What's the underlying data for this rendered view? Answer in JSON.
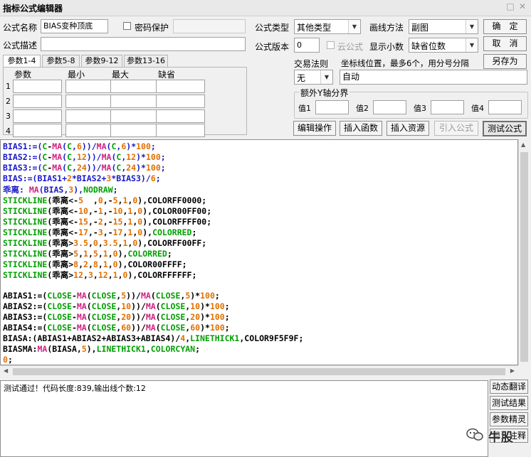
{
  "window": {
    "title": "指标公式编辑器"
  },
  "form": {
    "name_label": "公式名称",
    "name_value": "BIAS变种顶底",
    "password_label": "密码保护",
    "desc_label": "公式描述",
    "type_label": "公式类型",
    "type_value": "其他类型",
    "draw_label": "画线方法",
    "draw_value": "副图",
    "version_label": "公式版本",
    "version_value": "0",
    "cloud_label": "云公式",
    "decimals_label": "显示小数",
    "decimals_value": "缺省位数",
    "trade_rule_label": "交易法则",
    "trade_rule_value": "无",
    "coord_label": "坐标线位置，最多6个，用分号分隔",
    "coord_value": "自动",
    "yaxis_group_label": "额外Y轴分界",
    "yaxis_fields": [
      "值1",
      "值2",
      "值3",
      "值4"
    ]
  },
  "buttons": {
    "ok": "确　定",
    "cancel": "取　消",
    "save_as": "另存为",
    "edit_ops": "编辑操作",
    "insert_func": "插入函数",
    "insert_res": "插入资源",
    "import_formula": "引入公式",
    "test_formula": "测试公式"
  },
  "params": {
    "tabs": [
      "参数1-4",
      "参数5-8",
      "参数9-12",
      "参数13-16"
    ],
    "headers": [
      "参数",
      "最小",
      "最大",
      "缺省"
    ],
    "rows": [
      "1",
      "2",
      "3",
      "4"
    ]
  },
  "code_lines": [
    [
      [
        "BIAS1:=(",
        "#1818c8"
      ],
      [
        "C",
        "#00a000"
      ],
      [
        "-",
        "#000000"
      ],
      [
        "MA",
        "#d02080"
      ],
      [
        "(",
        "#1818c8"
      ],
      [
        "C",
        "#00a000"
      ],
      [
        ",",
        "#1818c8"
      ],
      [
        "6",
        "#e07000"
      ],
      [
        "))/",
        "#1818c8"
      ],
      [
        "MA",
        "#d02080"
      ],
      [
        "(",
        "#1818c8"
      ],
      [
        "C",
        "#00a000"
      ],
      [
        ",",
        "#1818c8"
      ],
      [
        "6",
        "#e07000"
      ],
      [
        ")*",
        "#1818c8"
      ],
      [
        "100",
        "#e07000"
      ],
      [
        ";",
        "#1818c8"
      ]
    ],
    [
      [
        "BIAS2:=(",
        "#1818c8"
      ],
      [
        "C",
        "#00a000"
      ],
      [
        "-",
        "#000000"
      ],
      [
        "MA",
        "#d02080"
      ],
      [
        "(",
        "#1818c8"
      ],
      [
        "C",
        "#00a000"
      ],
      [
        ",",
        "#1818c8"
      ],
      [
        "12",
        "#e07000"
      ],
      [
        "))/",
        "#1818c8"
      ],
      [
        "MA",
        "#d02080"
      ],
      [
        "(",
        "#1818c8"
      ],
      [
        "C",
        "#00a000"
      ],
      [
        ",",
        "#1818c8"
      ],
      [
        "12",
        "#e07000"
      ],
      [
        ")*",
        "#1818c8"
      ],
      [
        "100",
        "#e07000"
      ],
      [
        ";",
        "#1818c8"
      ]
    ],
    [
      [
        "BIAS3:=(",
        "#1818c8"
      ],
      [
        "C",
        "#00a000"
      ],
      [
        "-",
        "#000000"
      ],
      [
        "MA",
        "#d02080"
      ],
      [
        "(",
        "#1818c8"
      ],
      [
        "C",
        "#00a000"
      ],
      [
        ",",
        "#1818c8"
      ],
      [
        "24",
        "#e07000"
      ],
      [
        "))/",
        "#1818c8"
      ],
      [
        "MA",
        "#d02080"
      ],
      [
        "(",
        "#1818c8"
      ],
      [
        "C",
        "#00a000"
      ],
      [
        ",",
        "#1818c8"
      ],
      [
        "24",
        "#e07000"
      ],
      [
        ")*",
        "#1818c8"
      ],
      [
        "100",
        "#e07000"
      ],
      [
        ";",
        "#1818c8"
      ]
    ],
    [
      [
        "BIAS:=(BIAS1+",
        "#1818c8"
      ],
      [
        "2",
        "#e07000"
      ],
      [
        "*BIAS2+",
        "#1818c8"
      ],
      [
        "3",
        "#e07000"
      ],
      [
        "*BIAS3)/",
        "#1818c8"
      ],
      [
        "6",
        "#e07000"
      ],
      [
        ";",
        "#1818c8"
      ]
    ],
    [
      [
        "乖离:",
        "#1818c8"
      ],
      [
        " MA",
        "#d02080"
      ],
      [
        "(BIAS,",
        "#1818c8"
      ],
      [
        "3",
        "#e07000"
      ],
      [
        "),",
        "#1818c8"
      ],
      [
        "NODRAW",
        "#00a000"
      ],
      [
        ";",
        "#1818c8"
      ]
    ],
    [
      [
        "STICKLINE",
        "#00a000"
      ],
      [
        "(乖离<-",
        "#000000"
      ],
      [
        "5",
        "#e07000"
      ],
      [
        "  ,",
        "#000000"
      ],
      [
        "0",
        "#e07000"
      ],
      [
        ",-",
        "#000000"
      ],
      [
        "5",
        "#e07000"
      ],
      [
        ",",
        "#000000"
      ],
      [
        "1",
        "#e07000"
      ],
      [
        ",",
        "#000000"
      ],
      [
        "0",
        "#e07000"
      ],
      [
        "),COLORFF0000;",
        "#000000"
      ]
    ],
    [
      [
        "STICKLINE",
        "#00a000"
      ],
      [
        "(乖离<-",
        "#000000"
      ],
      [
        "10",
        "#e07000"
      ],
      [
        ",-",
        "#000000"
      ],
      [
        "1",
        "#e07000"
      ],
      [
        ",-",
        "#000000"
      ],
      [
        "10",
        "#e07000"
      ],
      [
        ",",
        "#000000"
      ],
      [
        "1",
        "#e07000"
      ],
      [
        ",",
        "#000000"
      ],
      [
        "0",
        "#e07000"
      ],
      [
        "),COLOR00FF00;",
        "#000000"
      ]
    ],
    [
      [
        "STICKLINE",
        "#00a000"
      ],
      [
        "(乖离<-",
        "#000000"
      ],
      [
        "15",
        "#e07000"
      ],
      [
        ",-",
        "#000000"
      ],
      [
        "2",
        "#e07000"
      ],
      [
        ",-",
        "#000000"
      ],
      [
        "15",
        "#e07000"
      ],
      [
        ",",
        "#000000"
      ],
      [
        "1",
        "#e07000"
      ],
      [
        ",",
        "#000000"
      ],
      [
        "0",
        "#e07000"
      ],
      [
        "),COLORFFFF00;",
        "#000000"
      ]
    ],
    [
      [
        "STICKLINE",
        "#00a000"
      ],
      [
        "(乖离<-",
        "#000000"
      ],
      [
        "17",
        "#e07000"
      ],
      [
        ",-",
        "#000000"
      ],
      [
        "3",
        "#e07000"
      ],
      [
        ",-",
        "#000000"
      ],
      [
        "17",
        "#e07000"
      ],
      [
        ",",
        "#000000"
      ],
      [
        "1",
        "#e07000"
      ],
      [
        ",",
        "#000000"
      ],
      [
        "0",
        "#e07000"
      ],
      [
        "),",
        "#000000"
      ],
      [
        "COLORRED",
        "#00a000"
      ],
      [
        ";",
        "#000000"
      ]
    ],
    [
      [
        "STICKLINE",
        "#00a000"
      ],
      [
        "(乖离>",
        "#000000"
      ],
      [
        "3.5",
        "#e07000"
      ],
      [
        ",",
        "#000000"
      ],
      [
        "0",
        "#e07000"
      ],
      [
        ",",
        "#000000"
      ],
      [
        "3.5",
        "#e07000"
      ],
      [
        ",",
        "#000000"
      ],
      [
        "1",
        "#e07000"
      ],
      [
        ",",
        "#000000"
      ],
      [
        "0",
        "#e07000"
      ],
      [
        "),COLORFF00FF;",
        "#000000"
      ]
    ],
    [
      [
        "STICKLINE",
        "#00a000"
      ],
      [
        "(乖离>",
        "#000000"
      ],
      [
        "5",
        "#e07000"
      ],
      [
        ",",
        "#000000"
      ],
      [
        "1",
        "#e07000"
      ],
      [
        ",",
        "#000000"
      ],
      [
        "5",
        "#e07000"
      ],
      [
        ",",
        "#000000"
      ],
      [
        "1",
        "#e07000"
      ],
      [
        ",",
        "#000000"
      ],
      [
        "0",
        "#e07000"
      ],
      [
        "),",
        "#000000"
      ],
      [
        "COLORRED",
        "#00a000"
      ],
      [
        ";",
        "#000000"
      ]
    ],
    [
      [
        "STICKLINE",
        "#00a000"
      ],
      [
        "(乖离>",
        "#000000"
      ],
      [
        "8",
        "#e07000"
      ],
      [
        ",",
        "#000000"
      ],
      [
        "2",
        "#e07000"
      ],
      [
        ",",
        "#000000"
      ],
      [
        "8",
        "#e07000"
      ],
      [
        ",",
        "#000000"
      ],
      [
        "1",
        "#e07000"
      ],
      [
        ",",
        "#000000"
      ],
      [
        "0",
        "#e07000"
      ],
      [
        "),COLOR00FFFF;",
        "#000000"
      ]
    ],
    [
      [
        "STICKLINE",
        "#00a000"
      ],
      [
        "(乖离>",
        "#000000"
      ],
      [
        "12",
        "#e07000"
      ],
      [
        ",",
        "#000000"
      ],
      [
        "3",
        "#e07000"
      ],
      [
        ",",
        "#000000"
      ],
      [
        "12",
        "#e07000"
      ],
      [
        ",",
        "#000000"
      ],
      [
        "1",
        "#e07000"
      ],
      [
        ",",
        "#000000"
      ],
      [
        "0",
        "#e07000"
      ],
      [
        "),COLORFFFFFF;",
        "#000000"
      ]
    ],
    [],
    [
      [
        "ABIAS1:=(",
        "#000000"
      ],
      [
        "CLOSE",
        "#00a000"
      ],
      [
        "-",
        "#000000"
      ],
      [
        "MA",
        "#d02080"
      ],
      [
        "(",
        "#000000"
      ],
      [
        "CLOSE",
        "#00a000"
      ],
      [
        ",",
        "#000000"
      ],
      [
        "5",
        "#e07000"
      ],
      [
        "))/",
        "#000000"
      ],
      [
        "MA",
        "#d02080"
      ],
      [
        "(",
        "#000000"
      ],
      [
        "CLOSE",
        "#00a000"
      ],
      [
        ",",
        "#000000"
      ],
      [
        "5",
        "#e07000"
      ],
      [
        ")*",
        "#000000"
      ],
      [
        "100",
        "#e07000"
      ],
      [
        ";",
        "#000000"
      ]
    ],
    [
      [
        "ABIAS2:=(",
        "#000000"
      ],
      [
        "CLOSE",
        "#00a000"
      ],
      [
        "-",
        "#000000"
      ],
      [
        "MA",
        "#d02080"
      ],
      [
        "(",
        "#000000"
      ],
      [
        "CLOSE",
        "#00a000"
      ],
      [
        ",",
        "#000000"
      ],
      [
        "10",
        "#e07000"
      ],
      [
        "))/",
        "#000000"
      ],
      [
        "MA",
        "#d02080"
      ],
      [
        "(",
        "#000000"
      ],
      [
        "CLOSE",
        "#00a000"
      ],
      [
        ",",
        "#000000"
      ],
      [
        "10",
        "#e07000"
      ],
      [
        ")*",
        "#000000"
      ],
      [
        "100",
        "#e07000"
      ],
      [
        ";",
        "#000000"
      ]
    ],
    [
      [
        "ABIAS3:=(",
        "#000000"
      ],
      [
        "CLOSE",
        "#00a000"
      ],
      [
        "-",
        "#000000"
      ],
      [
        "MA",
        "#d02080"
      ],
      [
        "(",
        "#000000"
      ],
      [
        "CLOSE",
        "#00a000"
      ],
      [
        ",",
        "#000000"
      ],
      [
        "20",
        "#e07000"
      ],
      [
        "))/",
        "#000000"
      ],
      [
        "MA",
        "#d02080"
      ],
      [
        "(",
        "#000000"
      ],
      [
        "CLOSE",
        "#00a000"
      ],
      [
        ",",
        "#000000"
      ],
      [
        "20",
        "#e07000"
      ],
      [
        ")*",
        "#000000"
      ],
      [
        "100",
        "#e07000"
      ],
      [
        ";",
        "#000000"
      ]
    ],
    [
      [
        "ABIAS4:=(",
        "#000000"
      ],
      [
        "CLOSE",
        "#00a000"
      ],
      [
        "-",
        "#000000"
      ],
      [
        "MA",
        "#d02080"
      ],
      [
        "(",
        "#000000"
      ],
      [
        "CLOSE",
        "#00a000"
      ],
      [
        ",",
        "#000000"
      ],
      [
        "60",
        "#e07000"
      ],
      [
        "))/",
        "#000000"
      ],
      [
        "MA",
        "#d02080"
      ],
      [
        "(",
        "#000000"
      ],
      [
        "CLOSE",
        "#00a000"
      ],
      [
        ",",
        "#000000"
      ],
      [
        "60",
        "#e07000"
      ],
      [
        ")*",
        "#000000"
      ],
      [
        "100",
        "#e07000"
      ],
      [
        ";",
        "#000000"
      ]
    ],
    [
      [
        "BIASA:(ABIAS1+ABIAS2+ABIAS3+ABIAS4)/",
        "#000000"
      ],
      [
        "4",
        "#e07000"
      ],
      [
        ",",
        "#000000"
      ],
      [
        "LINETHICK1",
        "#00a000"
      ],
      [
        ",COLOR9F5F9F;",
        "#000000"
      ]
    ],
    [
      [
        "BIASMA:",
        "#000000"
      ],
      [
        "MA",
        "#d02080"
      ],
      [
        "(BIASA,",
        "#000000"
      ],
      [
        "5",
        "#e07000"
      ],
      [
        "),",
        "#000000"
      ],
      [
        "LINETHICK1",
        "#00a000"
      ],
      [
        ",",
        "#000000"
      ],
      [
        "COLORCYAN",
        "#00a000"
      ],
      [
        ";",
        "#000000"
      ]
    ],
    [
      [
        "0",
        "#e07000"
      ],
      [
        ";",
        "#000000"
      ]
    ]
  ],
  "output": {
    "message": "测试通过！代码长度:839,输出线个数:12"
  },
  "side_buttons": [
    "动态翻译",
    "测试结果",
    "参数精灵",
    "用法注释"
  ],
  "watermark": "牛股"
}
